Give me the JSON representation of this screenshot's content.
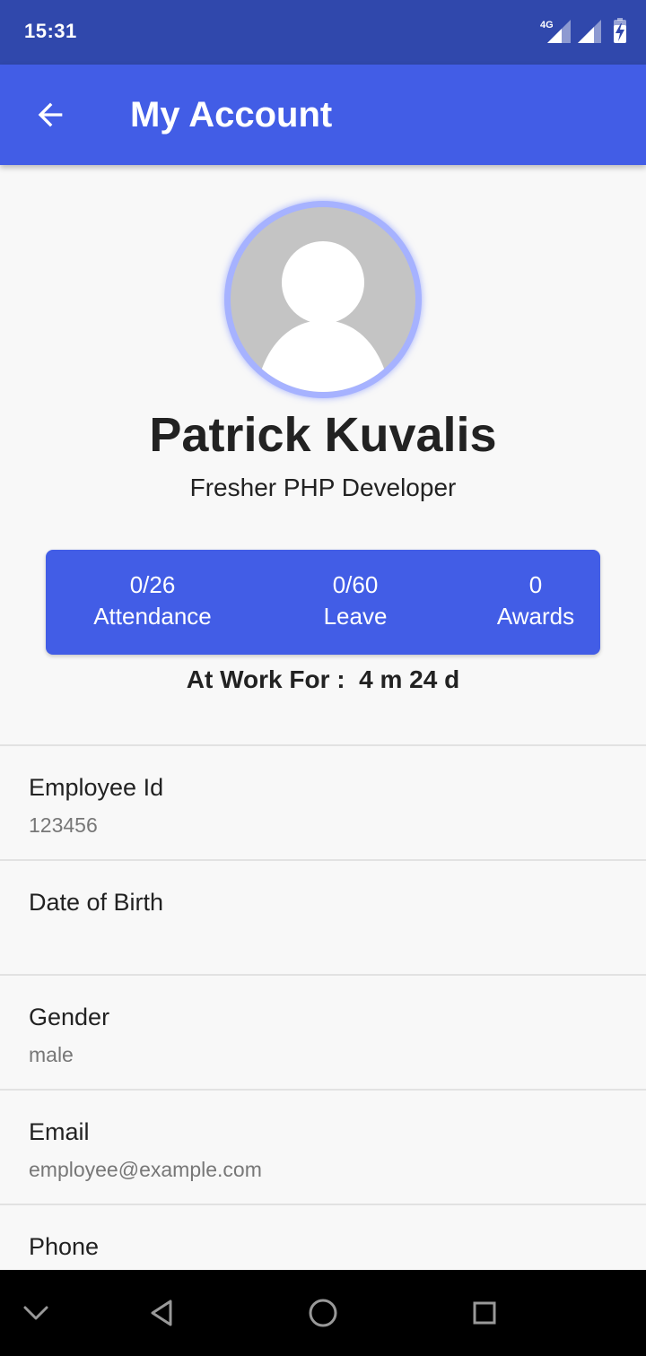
{
  "status_bar": {
    "time": "15:31",
    "network": "4G",
    "icons": [
      "signal-4g-icon",
      "signal-icon",
      "battery-charging-icon"
    ]
  },
  "app_bar": {
    "title": "My Account",
    "back_icon": "arrow-back-icon"
  },
  "profile": {
    "avatar_icon": "person-placeholder-icon",
    "name": "Patrick Kuvalis",
    "role": "Fresher PHP Developer"
  },
  "stats": [
    {
      "value": "0/26",
      "label": "Attendance"
    },
    {
      "value": "0/60",
      "label": "Leave"
    },
    {
      "value": "0",
      "label": "Awards"
    }
  ],
  "work_for": {
    "label": "At Work For :",
    "value": "4 m 24 d"
  },
  "info": [
    {
      "label": "Employee Id",
      "value": "123456"
    },
    {
      "label": "Date of Birth",
      "value": ""
    },
    {
      "label": "Gender",
      "value": "male"
    },
    {
      "label": "Email",
      "value": "employee@example.com"
    },
    {
      "label": "Phone",
      "value": ""
    }
  ],
  "nav_bar": {
    "icons": [
      "chevron-down-icon",
      "back-triangle-icon",
      "home-circle-icon",
      "recents-square-icon"
    ]
  },
  "colors": {
    "status_bar": "#3048ac",
    "primary": "#425de6",
    "avatar_ring": "#a6b2ff",
    "background": "#f8f8f8"
  }
}
